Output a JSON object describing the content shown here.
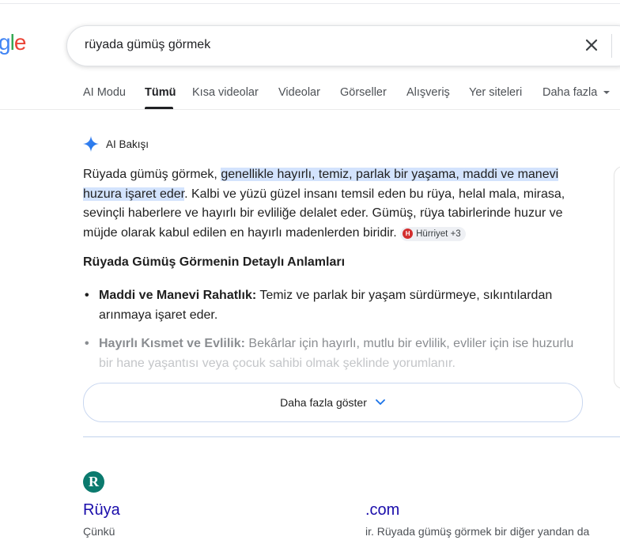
{
  "logo": {
    "text_g": "g",
    "text_l": "l",
    "text_e": "e"
  },
  "search": {
    "query": "rüyada gümüş görmek"
  },
  "tabs": [
    {
      "label": "AI Modu"
    },
    {
      "label": "Tümü"
    },
    {
      "label": "Kısa videolar"
    },
    {
      "label": "Videolar"
    },
    {
      "label": "Görseller"
    },
    {
      "label": "Alışveriş"
    },
    {
      "label": "Yer siteleri"
    },
    {
      "label": "Daha fazla"
    }
  ],
  "ai_overview": {
    "title": "AI Bakışı",
    "intro": "Rüyada gümüş görmek, ",
    "highlight": "genellikle hayırlı, temiz, parlak bir yaşama, maddi ve manevi huzura işaret eder",
    "rest": ". Kalbi ve yüzü güzel insanı temsil eden bu rüya, helal mala, mirasa, sevinçli haberlere ve hayırlı bir evliliğe delalet eder. Gümüş, rüya tabirlerinde huzur ve müjde olarak kabul edilen en hayırlı madenlerden biridir. ",
    "source_chip": "Hürriyet +3",
    "subheading": "Rüyada Gümüş Görmenin Detaylı Anlamları",
    "items": [
      {
        "bold": "Maddi ve Manevi Rahatlık:",
        "text": " Temiz ve parlak bir yaşam sürdürmeye, sıkıntılardan arınmaya işaret eder."
      },
      {
        "bold": "Hayırlı Kısmet ve Evlilik:",
        "text": " Bekârlar için hayırlı, mutlu bir evlilik, evliler için ise huzurlu",
        "text_faded": "bir hane yaşantısı veya çocuk sahibi olmak şeklinde yorumlanır."
      }
    ],
    "show_more": "Daha fazla göster"
  },
  "result": {
    "logo_letter": "R",
    "title_left": "Rüya",
    "title_right": ".com",
    "snippet_left": "Çünkü",
    "snippet_right": "ir. Rüyada gümüş görmek bir diğer yandan da"
  }
}
